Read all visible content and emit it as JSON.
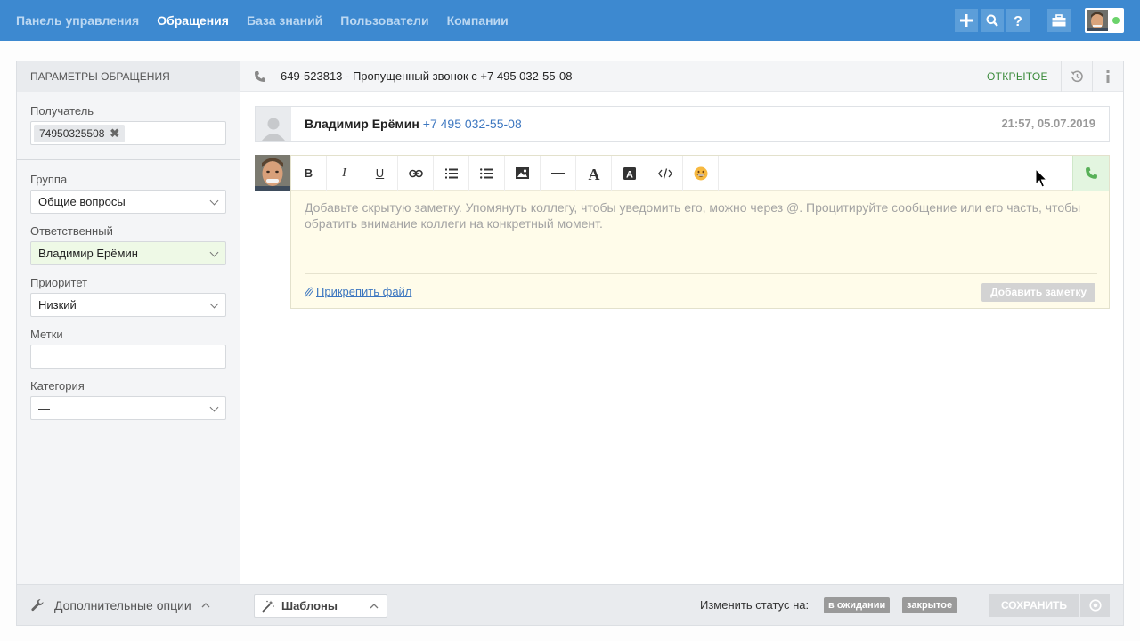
{
  "nav": {
    "items": [
      "Панель управления",
      "Обращения",
      "База знаний",
      "Пользователи",
      "Компании"
    ],
    "active_index": 1
  },
  "top_actions": [
    "plus-icon",
    "search-icon",
    "help-icon",
    "briefcase-icon"
  ],
  "sidebar": {
    "header": "Параметры обращения",
    "recipient_label": "Получатель",
    "recipient_tag": "74950325508",
    "group_label": "Группа",
    "group_value": "Общие вопросы",
    "assignee_label": "Ответственный",
    "assignee_value": "Владимир Ерёмин",
    "priority_label": "Приоритет",
    "priority_value": "Низкий",
    "tags_label": "Метки",
    "tags_value": "",
    "category_label": "Категория",
    "category_value": "—",
    "footer_label": "Дополнительные опции"
  },
  "ticket": {
    "title": "649-523813 - Пропущенный звонок с +7 495 032-55-08",
    "status": "ОТКРЫТОЕ"
  },
  "message": {
    "author": "Владимир Ерёмин",
    "phone": "+7 495 032-55-08",
    "time": "21:57, 05.07.2019"
  },
  "editor": {
    "tools": [
      "B",
      "I",
      "U",
      "link-icon",
      "ordered-list-icon",
      "bullet-list-icon",
      "image-icon",
      "horizontal-rule-icon",
      "font-icon",
      "font-color-icon",
      "code-icon",
      "emoji-icon"
    ],
    "placeholder": "Добавьте скрытую заметку. Упомянуть коллегу, чтобы уведомить его, можно через @. Процитируйте сообщение или его часть, чтобы обратить внимание коллеги на конкретный момент.",
    "attach_label": "Прикрепить файл",
    "add_note_label": "Добавить заметку"
  },
  "footer": {
    "templates_label": "Шаблоны",
    "change_status_label": "Изменить статус на:",
    "status_pending": "в ожидании",
    "status_closed": "закрытое",
    "save_label": "Сохранить"
  },
  "colors": {
    "topbar": "#3d89d0",
    "status_open": "#3a8a3a",
    "link": "#3d77c0",
    "note_bg": "#fffcea"
  }
}
